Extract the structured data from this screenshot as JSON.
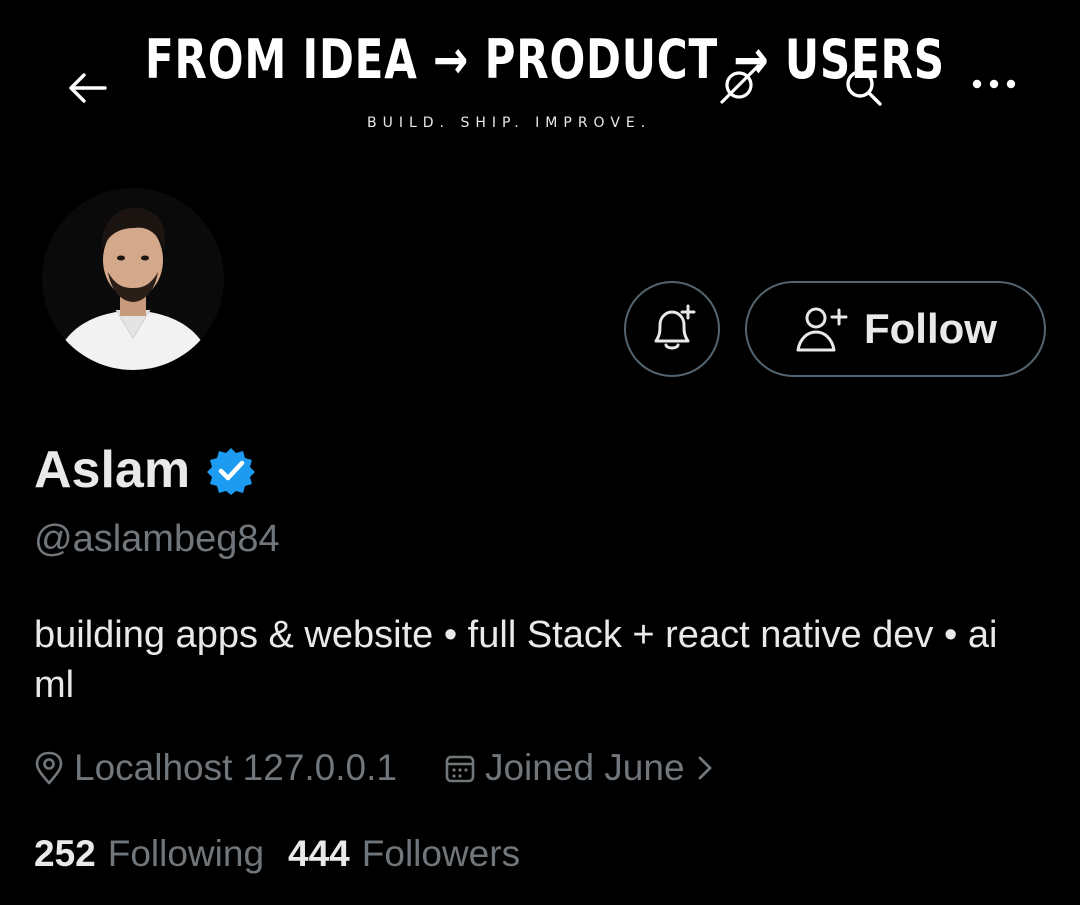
{
  "banner": {
    "headline": "FROM IDEA → PRODUCT → USERS",
    "tagline": "BUILD. SHIP. IMPROVE."
  },
  "topbar": {
    "back_icon": "arrow-left-icon",
    "media_icon": "grok-icon",
    "search_icon": "search-icon",
    "more_label": "..."
  },
  "profile": {
    "name": "Aslam",
    "verified": true,
    "handle": "@aslambeg84",
    "bio": "building apps & website  • full Stack + react native dev • ai ml",
    "location": "Localhost 127.0.0.1",
    "joined": "Joined June",
    "following_count": "252",
    "following_label": "Following",
    "followers_count": "444",
    "followers_label": "Followers"
  },
  "actions": {
    "follow_label": "Follow"
  },
  "colors": {
    "background": "#000000",
    "primary_text": "#e7e9ea",
    "secondary_text": "#71767b",
    "border": "#536471",
    "verified_blue": "#1d9bf0"
  }
}
